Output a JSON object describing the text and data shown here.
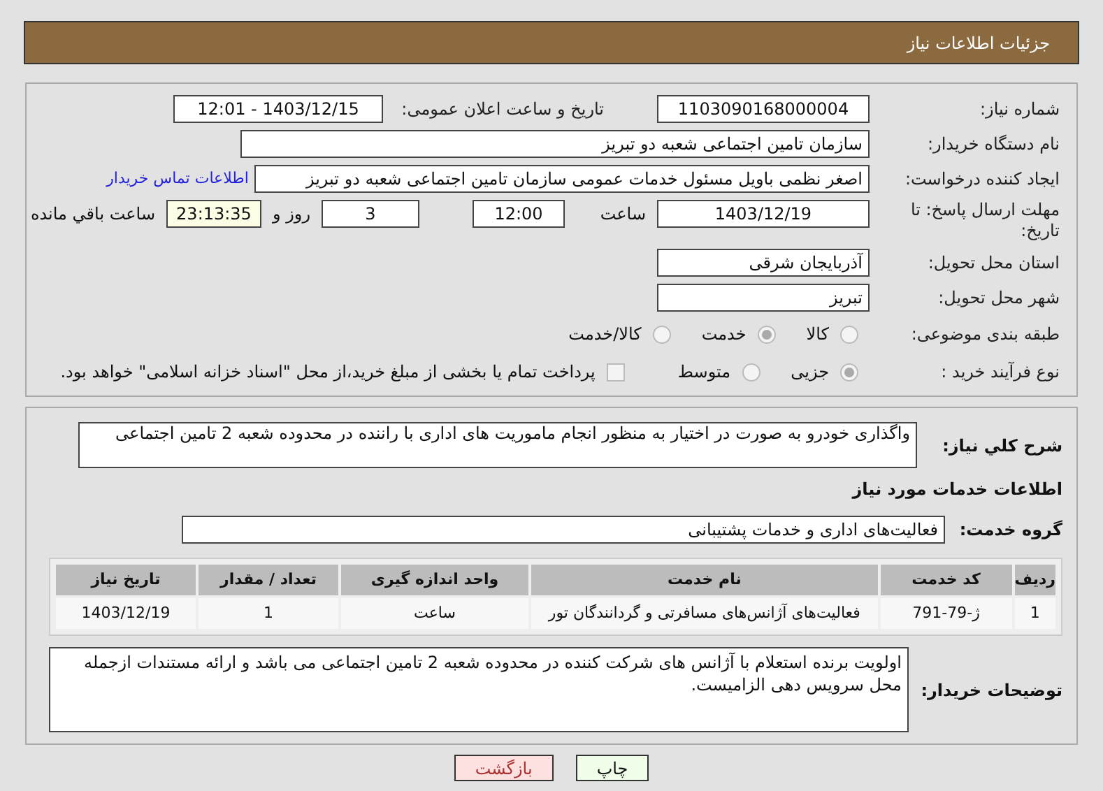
{
  "header": {
    "title": "جزئیات اطلاعات نیاز"
  },
  "need_number": {
    "label": "شماره نیاز:",
    "value": "1103090168000004"
  },
  "announce": {
    "label": "تاریخ و ساعت اعلان عمومی:",
    "value": "1403/12/15 - 12:01"
  },
  "buyer": {
    "label": "نام دستگاه خریدار:",
    "value": "سازمان تامین اجتماعی شعبه دو تبریز"
  },
  "creator": {
    "label": "ایجاد کننده درخواست:",
    "value": "اصغر نظمی باویل مسئول خدمات عمومی سازمان تامین اجتماعی شعبه دو تبریز",
    "link": "اطلاعات تماس خریدار"
  },
  "deadline": {
    "label": "مهلت ارسال پاسخ: تا تاریخ:",
    "date": "1403/12/19",
    "time_label": "ساعت",
    "time": "12:00",
    "days": "3",
    "days_label": "روز و",
    "remaining": "23:13:35",
    "remaining_label": "ساعت باقي مانده"
  },
  "province": {
    "label": "استان محل تحویل:",
    "value": "آذربایجان شرقی"
  },
  "city": {
    "label": "شهر محل تحویل:",
    "value": "تبریز"
  },
  "category": {
    "label": "طبقه بندی موضوعی:",
    "options": [
      {
        "label": "کالا",
        "selected": false
      },
      {
        "label": "خدمت",
        "selected": true
      },
      {
        "label": "کالا/خدمت",
        "selected": false
      }
    ]
  },
  "process": {
    "label": "نوع فرآیند خرید :",
    "options": [
      {
        "label": "جزیی",
        "selected": true
      },
      {
        "label": "متوسط",
        "selected": false
      }
    ],
    "treasury": {
      "label": "پرداخت تمام یا بخشی از مبلغ خرید،از محل \"اسناد خزانه اسلامی\" خواهد بود.",
      "checked": false
    }
  },
  "description": {
    "label": "شرح کلي نياز:",
    "value": "واگذاری خودرو به صورت در اختیار به منظور انجام ماموریت های اداری با راننده  در محدوده شعبه 2 تامین اجتماعی"
  },
  "services_heading": "اطلاعات خدمات مورد نیاز",
  "service_group": {
    "label": "گروه خدمت:",
    "value": "فعالیت‌های اداری و خدمات پشتیبانی"
  },
  "table": {
    "columns": [
      "ردیف",
      "کد خدمت",
      "نام خدمت",
      "واحد اندازه گیری",
      "تعداد / مقدار",
      "تاریخ نیاز"
    ],
    "rows": [
      [
        "1",
        "ژ-79-791",
        "فعالیت‌های آژانس‌های مسافرتی و گردانندگان تور",
        "ساعت",
        "1",
        "1403/12/19"
      ]
    ]
  },
  "buyer_notes": {
    "label": "توضیحات خریدار:",
    "value": "اولویت برنده استعلام با آژانس های شرکت کننده در محدوده شعبه 2 تامین اجتماعی می باشد و ارائه مستندات ازجمله محل سرویس دهی الزامیست."
  },
  "buttons": [
    {
      "label": "چاپ",
      "kind": "print"
    },
    {
      "label": "بازگشت",
      "kind": "back"
    }
  ]
}
